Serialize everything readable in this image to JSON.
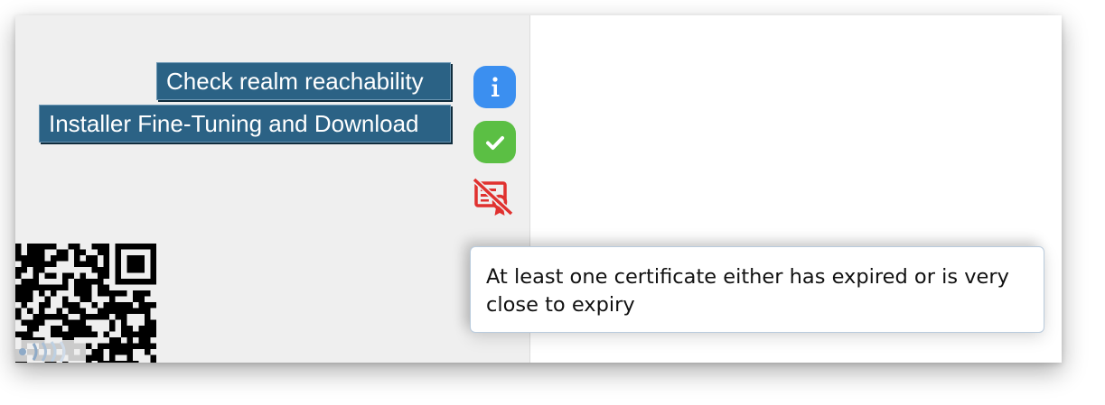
{
  "buttons": {
    "check_realm": "Check realm reachability",
    "installer": "Installer Fine-Tuning and Download"
  },
  "status_icons": [
    {
      "name": "info-icon",
      "color": "#3b8ff0",
      "glyph": "i"
    },
    {
      "name": "check-icon",
      "color": "#5bbf44"
    },
    {
      "name": "certificate-expired-icon",
      "color": "#e0312f"
    }
  ],
  "tooltip": {
    "text": "At least one certificate either has expired or is very close to expiry"
  },
  "colors": {
    "button_bg": "#2b6285",
    "panel_bg": "#efefef",
    "tooltip_border": "#b9cbdd"
  }
}
